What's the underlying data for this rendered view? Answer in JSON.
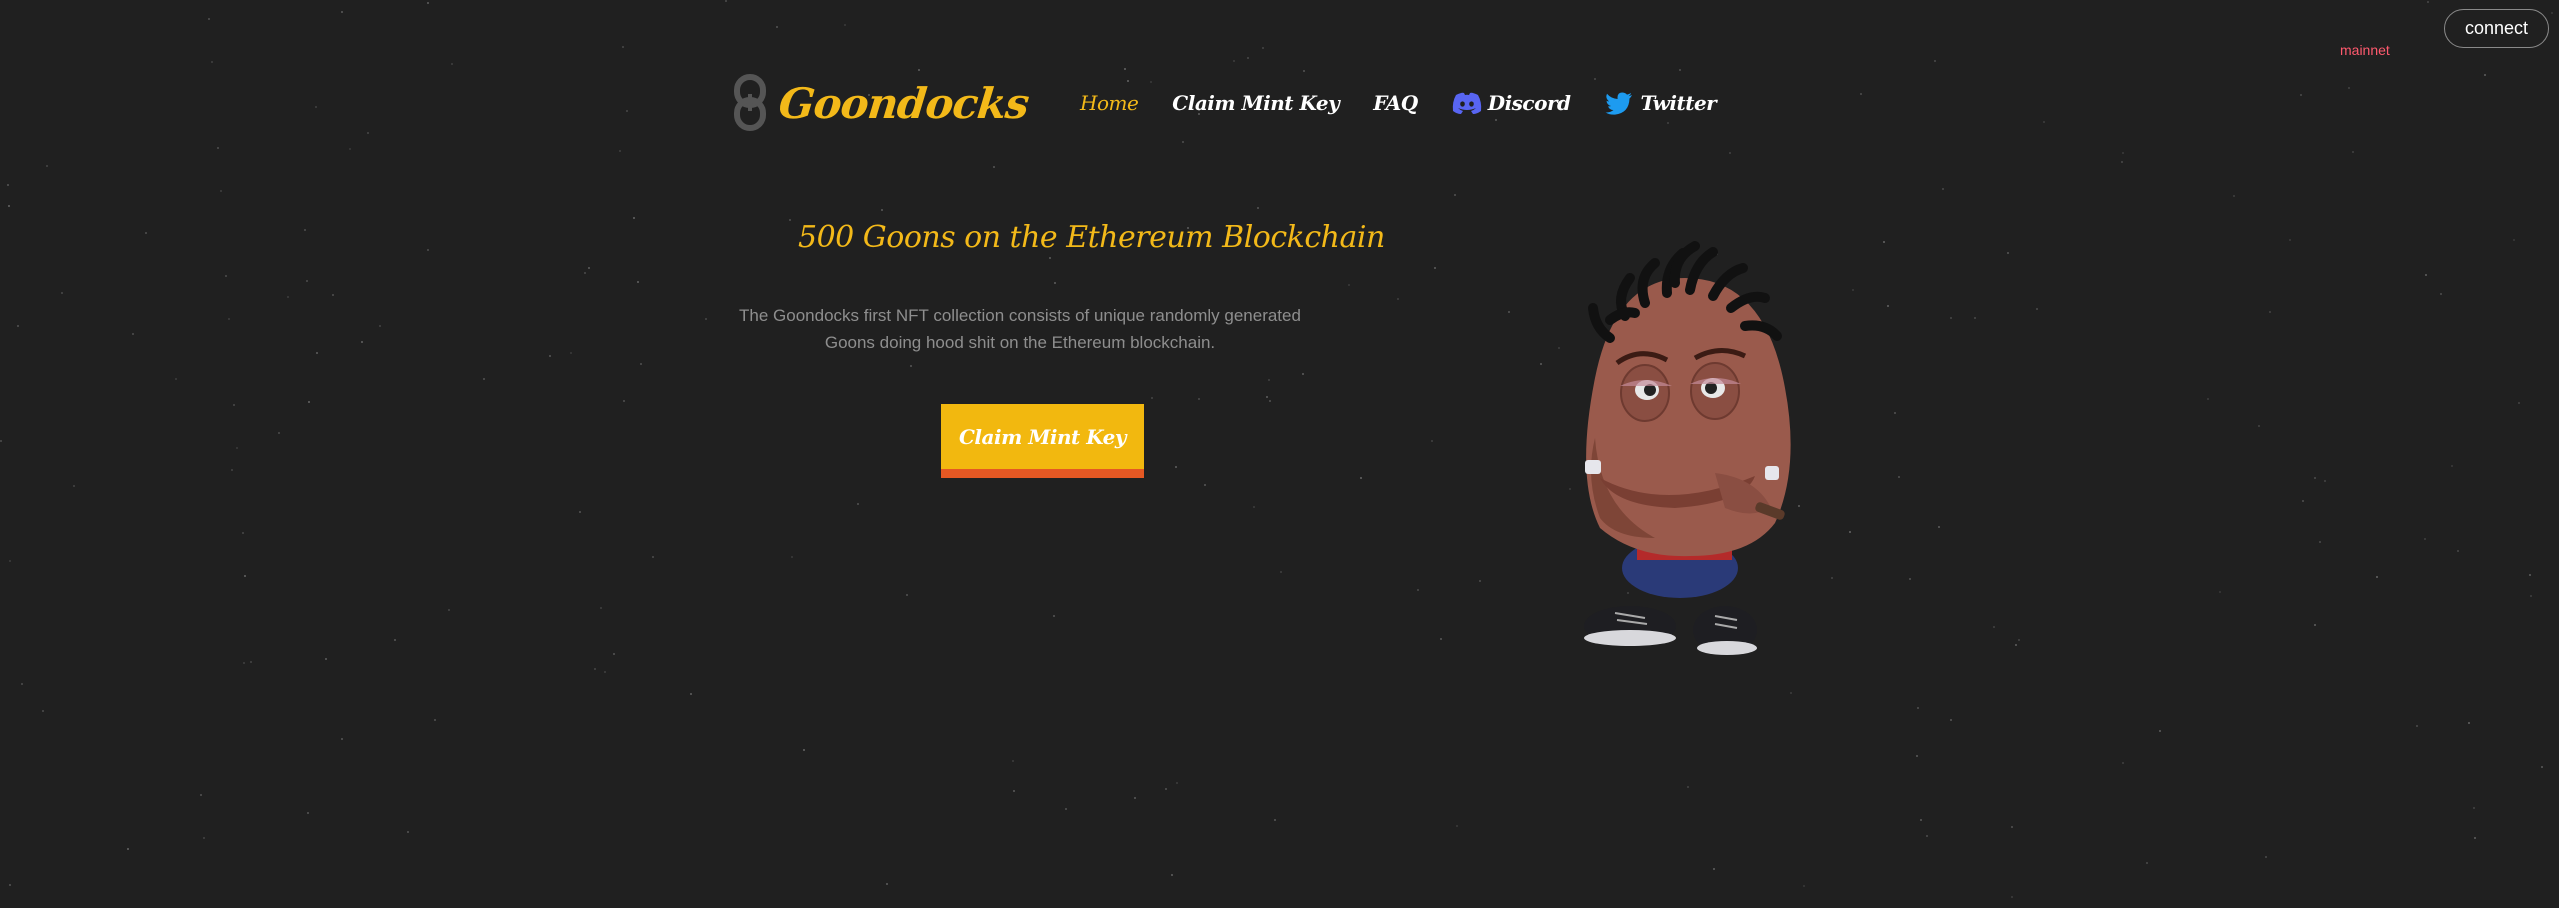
{
  "topbar": {
    "connect_label": "connect",
    "network_label": "mainnet"
  },
  "brand": {
    "name": "Goondocks",
    "logo_icon": "lock-icon"
  },
  "nav": {
    "items": [
      {
        "label": "Home",
        "active": true
      },
      {
        "label": "Claim Mint Key"
      },
      {
        "label": "FAQ"
      },
      {
        "label": "Discord",
        "icon": "discord-icon"
      },
      {
        "label": "Twitter",
        "icon": "twitter-icon"
      }
    ]
  },
  "hero": {
    "title": "500 Goons on the Ethereum Blockchain",
    "description": "The Goondocks first NFT collection consists of unique randomly generated Goons doing hood shit on the Ethereum blockchain.",
    "cta_label": "Claim Mint Key"
  },
  "colors": {
    "background": "#202020",
    "accent": "#f3b919",
    "cta_underline": "#e55823",
    "network": "#ff5a6e",
    "discord": "#5865f2",
    "twitter": "#1d9bf0"
  }
}
